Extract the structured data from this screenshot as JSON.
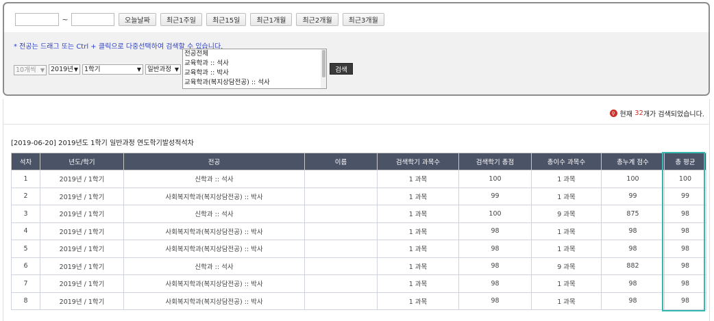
{
  "search": {
    "start_date": "",
    "end_date": "",
    "tilde": "~",
    "period_buttons": [
      "오늘날짜",
      "최근1주일",
      "최근15일",
      "최근1개월",
      "최근2개월",
      "최근3개월"
    ],
    "notice": "* 전공는 드래그 또는 Ctrl + 클릭으로 다중선택하여 검색할 수 있습니다.",
    "page_size": "10개씩",
    "year": "2019년",
    "semester": "1학기",
    "course": "일반과정",
    "majors": [
      "전공전체",
      "교육학과 :: 석사",
      "교육학과 :: 박사",
      "교육학과(복지상담전공) :: 석사"
    ],
    "search_label": "검색",
    "arrow": "▼"
  },
  "result": {
    "icon": "magnifier-icon",
    "prefix": "현재",
    "count": "32",
    "suffix": "개가 검색되었습니다.",
    "title": "[2019-06-20] 2019년도 1학기 일반과정 연도학기발성적석차"
  },
  "table": {
    "headers": [
      "석차",
      "년도/학기",
      "전공",
      "이름",
      "검색학기 과목수",
      "검색학기 총점",
      "총이수 과목수",
      "총누계 점수",
      "총 평균"
    ],
    "rows": [
      [
        "1",
        "2019년 / 1학기",
        "신학과 :: 석사",
        "",
        "1 과목",
        "100",
        "1 과목",
        "100",
        "100"
      ],
      [
        "2",
        "2019년 / 1학기",
        "사회복지학과(복지상담전공) :: 박사",
        "",
        "1 과목",
        "99",
        "1 과목",
        "99",
        "99"
      ],
      [
        "3",
        "2019년 / 1학기",
        "신학과 :: 석사",
        "",
        "1 과목",
        "100",
        "9 과목",
        "875",
        "98"
      ],
      [
        "4",
        "2019년 / 1학기",
        "사회복지학과(복지상담전공) :: 박사",
        "",
        "1 과목",
        "98",
        "1 과목",
        "98",
        "98"
      ],
      [
        "5",
        "2019년 / 1학기",
        "사회복지학과(복지상담전공) :: 박사",
        "",
        "1 과목",
        "98",
        "1 과목",
        "98",
        "98"
      ],
      [
        "6",
        "2019년 / 1학기",
        "신학과 :: 석사",
        "",
        "1 과목",
        "98",
        "9 과목",
        "882",
        "98"
      ],
      [
        "7",
        "2019년 / 1학기",
        "사회복지학과(복지상담전공) :: 박사",
        "",
        "1 과목",
        "98",
        "1 과목",
        "98",
        "98"
      ],
      [
        "8",
        "2019년 / 1학기",
        "사회복지학과(복지상담전공) :: 박사",
        "",
        "1 과목",
        "98",
        "1 과목",
        "98",
        "98"
      ]
    ]
  },
  "colors": {
    "header_bg": "#4b5366",
    "highlight": "#33b7ae",
    "count": "#c9302c",
    "notice": "#2c3ec7"
  }
}
